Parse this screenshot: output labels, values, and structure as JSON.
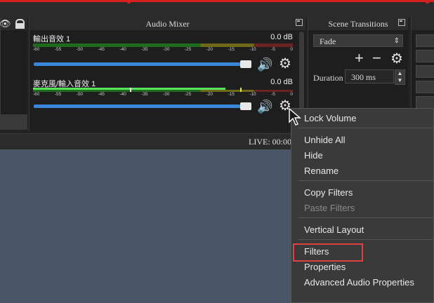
{
  "mixer": {
    "title": "Audio Mixer",
    "channels": [
      {
        "name": "輸出音效 1",
        "db": "0.0 dB",
        "volume_fraction": 0.98
      },
      {
        "name": "麥克風/輸入音效 1",
        "db": "0.0 dB",
        "volume_fraction": 0.98
      }
    ],
    "ticks": [
      "-60",
      "-55",
      "-50",
      "-45",
      "-40",
      "-35",
      "-30",
      "-25",
      "-20",
      "-15",
      "-10",
      "-5",
      "0"
    ]
  },
  "transitions": {
    "title": "Scene Transitions",
    "selected": "Fade",
    "duration_label": "Duration",
    "duration_value": "300 ms"
  },
  "status": {
    "live": "LIVE: 00:00"
  },
  "context_menu": {
    "items": [
      {
        "label": "Lock Volume",
        "enabled": true
      },
      {
        "label": "Unhide All",
        "enabled": true
      },
      {
        "label": "Hide",
        "enabled": true
      },
      {
        "label": "Rename",
        "enabled": true
      },
      {
        "label": "Copy Filters",
        "enabled": true
      },
      {
        "label": "Paste Filters",
        "enabled": false
      },
      {
        "label": "Vertical Layout",
        "enabled": true
      },
      {
        "label": "Filters",
        "enabled": true,
        "highlighted": true
      },
      {
        "label": "Properties",
        "enabled": true
      },
      {
        "label": "Advanced Audio Properties",
        "enabled": true
      }
    ]
  },
  "colors": {
    "accent_red": "#e04141",
    "slider_blue": "#3a87d9"
  }
}
